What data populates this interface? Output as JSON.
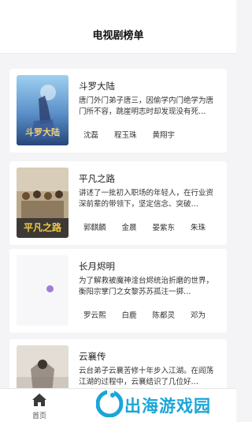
{
  "header": {
    "title": "电视剧榜单"
  },
  "dramas": [
    {
      "title": "斗罗大陆",
      "desc": "唐门外门弟子唐三，因偷学内门绝学为唐门所不容，跳崖明志时却发现没有死…",
      "cast": [
        "沈磊",
        "程玉珠",
        "黄翔宇"
      ],
      "poster_caption": "斗罗大陆"
    },
    {
      "title": "平凡之路",
      "desc": "讲述了一批初入职场的年轻人，在行业资深前辈的带领下，坚定信念、突破…",
      "cast": [
        "郭麒麟",
        "金晨",
        "晏紫东",
        "朱珠"
      ],
      "poster_caption": "平凡之路"
    },
    {
      "title": "长月烬明",
      "desc": "为了解救被魔神淦台烬统治折磨的世界，衡阳宗掌门之女黎苏苏孤注一掷…",
      "cast": [
        "罗云熙",
        "白鹿",
        "陈都灵",
        "邓为"
      ]
    },
    {
      "title": "云襄传",
      "desc": "云台弟子云襄苦修十年步入江湖。在阎荡江湖的过程中，云襄结识了几位好…",
      "cast": []
    }
  ],
  "tabbar": {
    "home_label": "首页"
  },
  "watermark": {
    "text": "出海游戏园"
  },
  "colors": {
    "accent": "#1aa6d8",
    "background": "#f4f4f6"
  }
}
